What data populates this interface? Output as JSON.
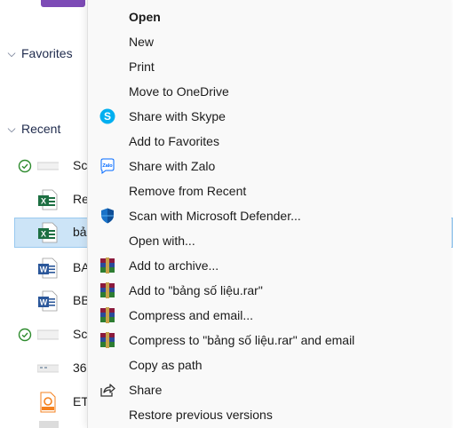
{
  "explorer": {
    "sections": [
      {
        "label": "Favorites",
        "chevron": "chevron-down"
      },
      {
        "label": "Recent",
        "chevron": "chevron-down"
      }
    ],
    "files": [
      {
        "name": "Sc",
        "type": "image",
        "status": "synced"
      },
      {
        "name": "Re",
        "type": "excel",
        "status": ""
      },
      {
        "name": "bả",
        "type": "excel",
        "status": "",
        "selected": true
      },
      {
        "name": "BA",
        "type": "word",
        "status": ""
      },
      {
        "name": "BB",
        "type": "word",
        "status": ""
      },
      {
        "name": "Sc",
        "type": "image",
        "status": "synced"
      },
      {
        "name": "36",
        "type": "image",
        "status": ""
      },
      {
        "name": "ET",
        "type": "pdf",
        "status": ""
      }
    ]
  },
  "context_menu": {
    "items": [
      {
        "label": "Open",
        "bold": true,
        "icon": ""
      },
      {
        "label": "New",
        "icon": ""
      },
      {
        "label": "Print",
        "icon": ""
      },
      {
        "label": "Move to OneDrive",
        "icon": ""
      },
      {
        "label": "Share with Skype",
        "icon": "skype-icon"
      },
      {
        "label": "Add to Favorites",
        "icon": ""
      },
      {
        "label": "Share with Zalo",
        "icon": "zalo-icon",
        "icon_text": "Zalo"
      },
      {
        "label": "Remove from Recent",
        "icon": ""
      },
      {
        "label": "Scan with Microsoft Defender...",
        "icon": "defender-shield-icon"
      },
      {
        "label": "Open with...",
        "icon": ""
      },
      {
        "label": "Add to archive...",
        "icon": "winrar-icon"
      },
      {
        "label": "Add to \"bảng số liệu.rar\"",
        "icon": "winrar-icon"
      },
      {
        "label": "Compress and email...",
        "icon": "winrar-icon"
      },
      {
        "label": "Compress to \"bảng số liệu.rar\" and email",
        "icon": "winrar-icon"
      },
      {
        "label": "Copy as path",
        "icon": ""
      },
      {
        "label": "Share",
        "icon": "share-icon"
      },
      {
        "label": "Restore previous versions",
        "icon": ""
      }
    ]
  },
  "colors": {
    "excel": "#1d6f42",
    "word": "#2b579a",
    "pdf": "#f5821f",
    "selected_bg": "#cce4f7",
    "synced": "#2e8b2e"
  }
}
